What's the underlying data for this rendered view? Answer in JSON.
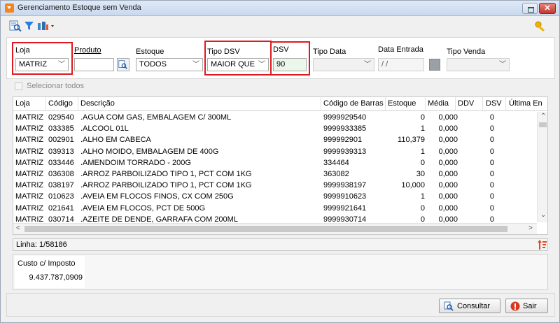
{
  "window": {
    "title": "Gerenciamento Estoque sem Venda"
  },
  "filters": {
    "loja": {
      "label": "Loja",
      "value": "MATRIZ"
    },
    "produto": {
      "label": "Produto",
      "value": ""
    },
    "estoque": {
      "label": "Estoque",
      "value": "TODOS"
    },
    "tipo_dsv": {
      "label": "Tipo DSV",
      "value": "MAIOR QUE"
    },
    "dsv": {
      "label": "DSV",
      "value": "90"
    },
    "tipo_data": {
      "label": "Tipo Data",
      "value": ""
    },
    "data_entrada": {
      "label": "Data Entrada",
      "value": " / /"
    },
    "tipo_venda": {
      "label": "Tipo Venda",
      "value": ""
    }
  },
  "select_all": {
    "label": "Selecionar todos",
    "checked": false
  },
  "grid": {
    "columns": [
      "Loja",
      "Código",
      "Descrição",
      "Código de Barras",
      "Estoque",
      "Média",
      "DDV",
      "DSV",
      "Última En"
    ],
    "rows": [
      [
        "MATRIZ",
        "029540",
        ".AGUA COM GAS, EMBALAGEM C/ 300ML",
        "9999929540",
        "0",
        "0,000",
        "0"
      ],
      [
        "MATRIZ",
        "033385",
        ".ALCOOL 01L",
        "9999933385",
        "1",
        "0,000",
        "0"
      ],
      [
        "MATRIZ",
        "002901",
        ".ALHO EM CABECA",
        "999992901",
        "110,379",
        "0,000",
        "0"
      ],
      [
        "MATRIZ",
        "039313",
        ".ALHO MOIDO, EMBALAGEM DE 400G",
        "9999939313",
        "1",
        "0,000",
        "0"
      ],
      [
        "MATRIZ",
        "033446",
        ".AMENDOIM TORRADO - 200G",
        "334464",
        "0",
        "0,000",
        "0"
      ],
      [
        "MATRIZ",
        "036308",
        ".ARROZ PARBOILIZADO TIPO 1, PCT COM 1KG",
        "363082",
        "30",
        "0,000",
        "0"
      ],
      [
        "MATRIZ",
        "038197",
        ".ARROZ PARBOILIZADO TIPO 1, PCT COM 1KG",
        "9999938197",
        "10,000",
        "0,000",
        "0"
      ],
      [
        "MATRIZ",
        "010623",
        ".AVEIA EM FLOCOS FINOS, CX COM 250G",
        "9999910623",
        "1",
        "0,000",
        "0"
      ],
      [
        "MATRIZ",
        "021641",
        ".AVEIA EM FLOCOS, PCT DE 500G",
        "9999921641",
        "0",
        "0,000",
        "0"
      ],
      [
        "MATRIZ",
        "030714",
        ".AZEITE DE DENDE, GARRAFA COM 200ML",
        "9999930714",
        "0",
        "0,000",
        "0"
      ]
    ]
  },
  "status": {
    "linha": "Linha: 1/58186"
  },
  "summary": {
    "label": "Custo c/ Imposto",
    "value": "9.437.787,0909"
  },
  "buttons": {
    "consultar": "Consultar",
    "sair": "Sair"
  },
  "colors": {
    "highlight_red": "#e0181f",
    "accent_orange": "#f3841e"
  }
}
